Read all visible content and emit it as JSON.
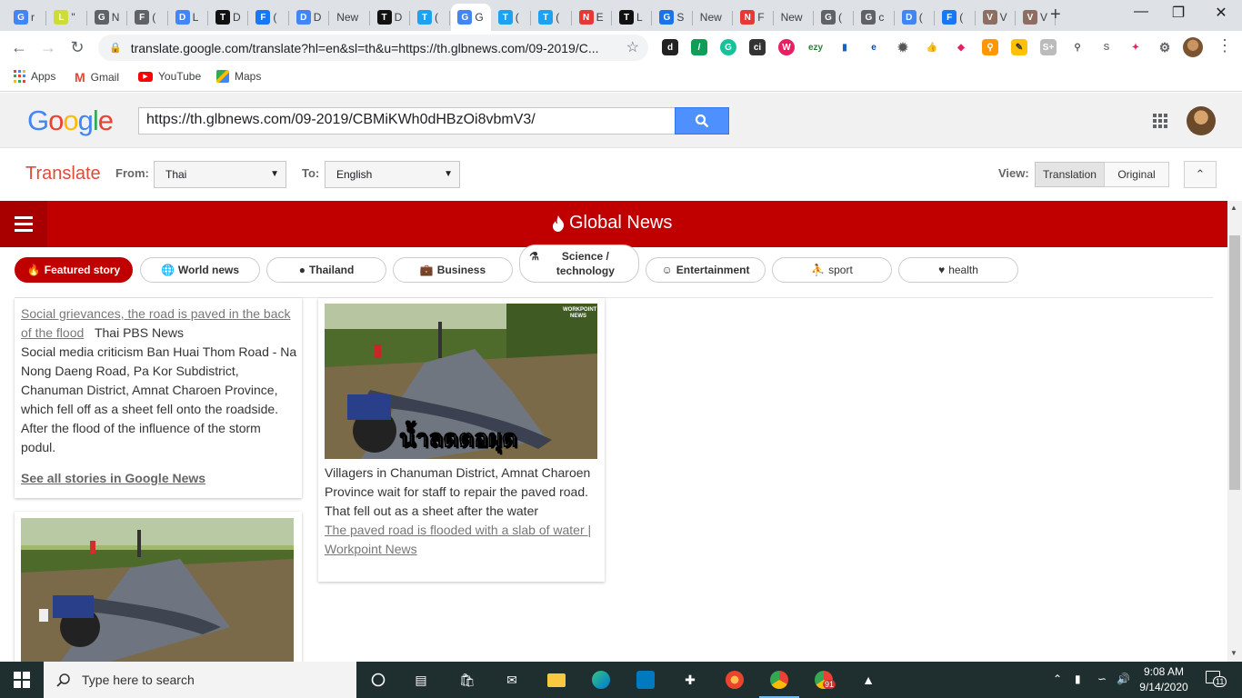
{
  "browser": {
    "tabs": [
      {
        "icon": "google-icon",
        "label": "r",
        "color": "#4285f4"
      },
      {
        "icon": "lighthouse-icon",
        "label": "\"",
        "color": "#cddc39"
      },
      {
        "icon": "globe-icon",
        "label": "N",
        "color": "#5f6368"
      },
      {
        "icon": "folder-icon",
        "label": "(",
        "color": "#5f6368"
      },
      {
        "icon": "docs-icon",
        "label": "L",
        "color": "#4285f4"
      },
      {
        "icon": "tiktok-icon",
        "label": "D",
        "color": "#111111"
      },
      {
        "icon": "facebook-icon",
        "label": "(",
        "color": "#1877f2"
      },
      {
        "icon": "docs-icon",
        "label": "D",
        "color": "#4285f4"
      },
      {
        "icon": "none",
        "label": "New",
        "color": "#dee1e6"
      },
      {
        "icon": "tiktok-icon",
        "label": "D",
        "color": "#111111"
      },
      {
        "icon": "twitter-icon",
        "label": "(",
        "color": "#1da1f2"
      },
      {
        "icon": "google-icon",
        "label": "G",
        "color": "#4285f4",
        "active": true
      },
      {
        "icon": "twitter-icon",
        "label": "(",
        "color": "#1da1f2"
      },
      {
        "icon": "twitter-icon",
        "label": "(",
        "color": "#1da1f2"
      },
      {
        "icon": "news-icon",
        "label": "E",
        "color": "#e53935"
      },
      {
        "icon": "tiktok-icon",
        "label": "L",
        "color": "#111111"
      },
      {
        "icon": "gear-icon",
        "label": "S",
        "color": "#1a73e8"
      },
      {
        "icon": "none",
        "label": "New",
        "color": "#dee1e6"
      },
      {
        "icon": "news-icon",
        "label": "F",
        "color": "#e53935"
      },
      {
        "icon": "none",
        "label": "New",
        "color": "#dee1e6"
      },
      {
        "icon": "globe-icon",
        "label": "(",
        "color": "#5f6368"
      },
      {
        "icon": "globe-icon",
        "label": "c",
        "color": "#5f6368"
      },
      {
        "icon": "docs-icon",
        "label": "(",
        "color": "#4285f4"
      },
      {
        "icon": "facebook-icon",
        "label": "(",
        "color": "#1877f2"
      },
      {
        "icon": "video-icon",
        "label": "V",
        "color": "#8d6e63"
      },
      {
        "icon": "video-icon",
        "label": "V",
        "color": "#8d6e63"
      }
    ],
    "url": "translate.google.com/translate?hl=en&sl=th&u=https://th.glbnews.com/09-2019/C...",
    "bookmarks": [
      {
        "label": "Apps",
        "icon": "apps-grid-icon"
      },
      {
        "label": "Gmail",
        "icon": "gmail-icon"
      },
      {
        "label": "YouTube",
        "icon": "youtube-icon"
      },
      {
        "label": "Maps",
        "icon": "maps-icon"
      }
    ]
  },
  "translate": {
    "logo": [
      "G",
      "o",
      "o",
      "g",
      "l",
      "e"
    ],
    "logo_colors": [
      "#4285f4",
      "#ea4335",
      "#fbbc05",
      "#4285f4",
      "#34a853",
      "#ea4335"
    ],
    "url_value": "https://th.glbnews.com/09-2019/CBMiKWh0dHBzOi8vbmV3/",
    "title": "Translate",
    "from_label": "From:",
    "from_value": "Thai",
    "to_label": "To:",
    "to_value": "English",
    "view_label": "View:",
    "view_translation": "Translation",
    "view_original": "Original"
  },
  "site": {
    "title": "Global News",
    "categories": [
      {
        "label": "Featured story",
        "icon": "fire-icon",
        "active": true
      },
      {
        "label": "World news",
        "icon": "globe-icon"
      },
      {
        "label": "Thailand",
        "icon": "map-pin-icon"
      },
      {
        "label": "Business",
        "icon": "briefcase-icon"
      },
      {
        "label": "Science / technology",
        "icon": "flask-icon"
      },
      {
        "label": "Entertainment",
        "icon": "masks-icon"
      },
      {
        "label": "sport",
        "icon": "running-icon"
      },
      {
        "label": "health",
        "icon": "heart-icon"
      }
    ],
    "story_left": {
      "link": "Social grievances, the road is paved in the back of the flood",
      "source": "Thai PBS News",
      "body": "Social media criticism Ban Huai Thom Road - Na Nong Daeng Road, Pa Kor Subdistrict, Chanuman District, Amnat Charoen Province, which fell off as a sheet fell onto the roadside. After the flood of the influence of the storm podul.",
      "see_all": "See all stories in Google News"
    },
    "story_right": {
      "image_caption": "น้ำลดตอผุด",
      "image_watermark": "WORKPOINT NEWS",
      "body": "Villagers in Chanuman District, Amnat Charoen Province wait for staff to repair the paved road. That fell out as a sheet after the water",
      "link": "The paved road is flooded with a slab of water | Workpoint News"
    }
  },
  "taskbar": {
    "search_placeholder": "Type here to search",
    "time": "9:08 AM",
    "date": "9/14/2020",
    "notification_count": "11",
    "badge_count": "91"
  }
}
